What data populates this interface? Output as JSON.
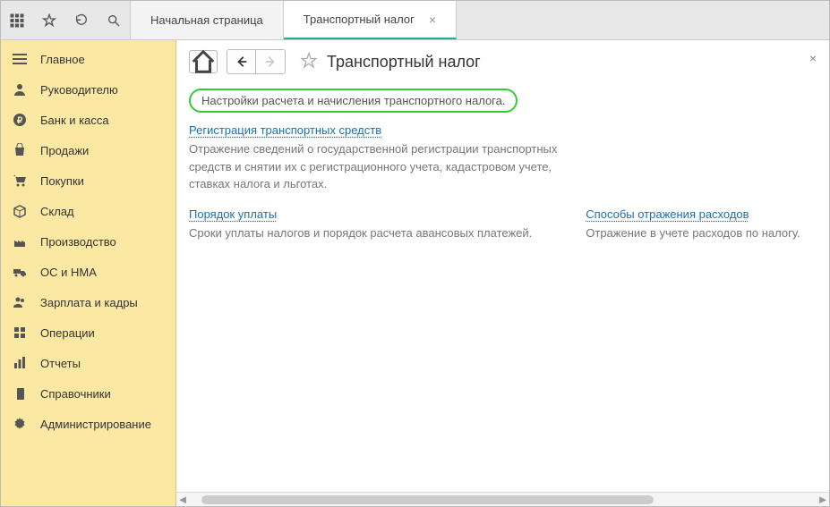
{
  "tabs": [
    {
      "label": "Начальная страница",
      "active": false,
      "closable": false
    },
    {
      "label": "Транспортный налог",
      "active": true,
      "closable": true
    }
  ],
  "sidebar": {
    "items": [
      {
        "label": "Главное"
      },
      {
        "label": "Руководителю"
      },
      {
        "label": "Банк и касса"
      },
      {
        "label": "Продажи"
      },
      {
        "label": "Покупки"
      },
      {
        "label": "Склад"
      },
      {
        "label": "Производство"
      },
      {
        "label": "ОС и НМА"
      },
      {
        "label": "Зарплата и кадры"
      },
      {
        "label": "Операции"
      },
      {
        "label": "Отчеты"
      },
      {
        "label": "Справочники"
      },
      {
        "label": "Администрирование"
      }
    ]
  },
  "page": {
    "title": "Транспортный налог",
    "highlight_note": "Настройки расчета и начисления транспортного налога.",
    "blocks": {
      "registration": {
        "link": "Регистрация транспортных средств",
        "desc": "Отражение сведений о государственной регистрации транспортных средств и снятии их с регистрационного учета, кадастровом учете, ставках налога и льготах."
      },
      "payment": {
        "link": "Порядок уплаты",
        "desc": "Сроки уплаты налогов и порядок расчета авансовых платежей."
      },
      "expenses": {
        "link": "Способы отражения расходов",
        "desc": "Отражение в учете расходов по налогу."
      }
    }
  }
}
